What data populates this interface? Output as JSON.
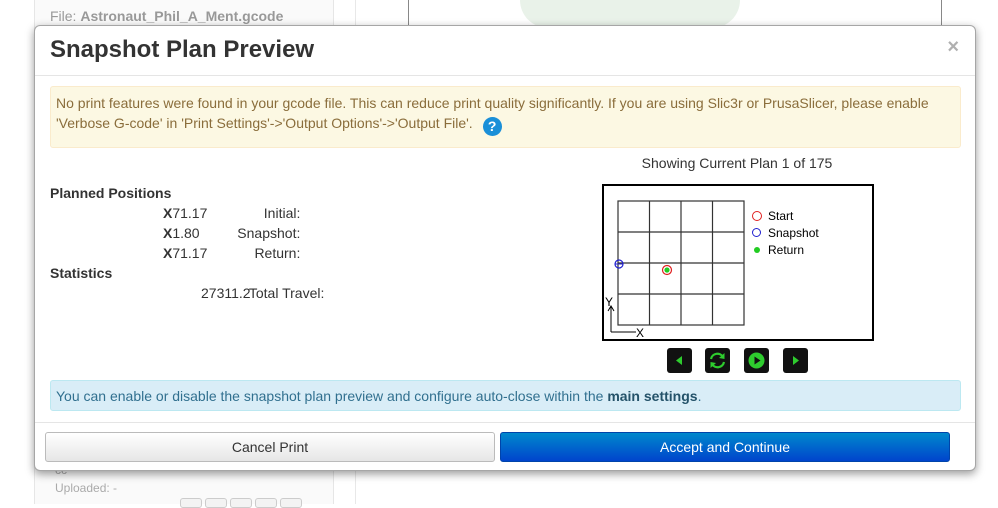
{
  "background": {
    "file_label": "File:",
    "file_name": "Astronaut_Phil_A_Ment.gcode",
    "cc_text": "cc",
    "uploaded_label": "Uploaded: -"
  },
  "modal": {
    "title": "Snapshot Plan Preview",
    "close_label": "×",
    "warning_text": "No print features were found in your gcode file. This can reduce print quality significantly. If you are using Slic3r or PrusaSlicer, please enable 'Verbose G-code' in 'Print Settings'->'Output Options'->'Output File'.",
    "help_label": "?",
    "plan_status": "Showing Current Plan 1 of 175",
    "planned_positions_heading": "Planned Positions",
    "positions": {
      "initial_label": "Initial:",
      "initial_axis": "X",
      "initial_value": "71.17",
      "snapshot_label": "Snapshot:",
      "snapshot_axis": "X",
      "snapshot_value": "1.80",
      "return_label": "Return:",
      "return_axis": "X",
      "return_value": "71.17"
    },
    "statistics_heading": "Statistics",
    "total_travel_label": "Total Travel:",
    "total_travel_value": "27311.2",
    "legend": {
      "start": "Start",
      "snapshot": "Snapshot",
      "return": "Return"
    },
    "axis_x": "X",
    "axis_y": "Y",
    "info_text": "You can enable or disable the snapshot plan preview and configure auto-close within the ",
    "info_link": "main settings",
    "info_end": ".",
    "cancel_label": "Cancel Print",
    "accept_label": "Accept and Continue"
  },
  "colors": {
    "start_marker": "#e02020",
    "snapshot_marker": "#2020d0",
    "return_marker": "#22cc22",
    "accept_button": "#0055cc"
  }
}
